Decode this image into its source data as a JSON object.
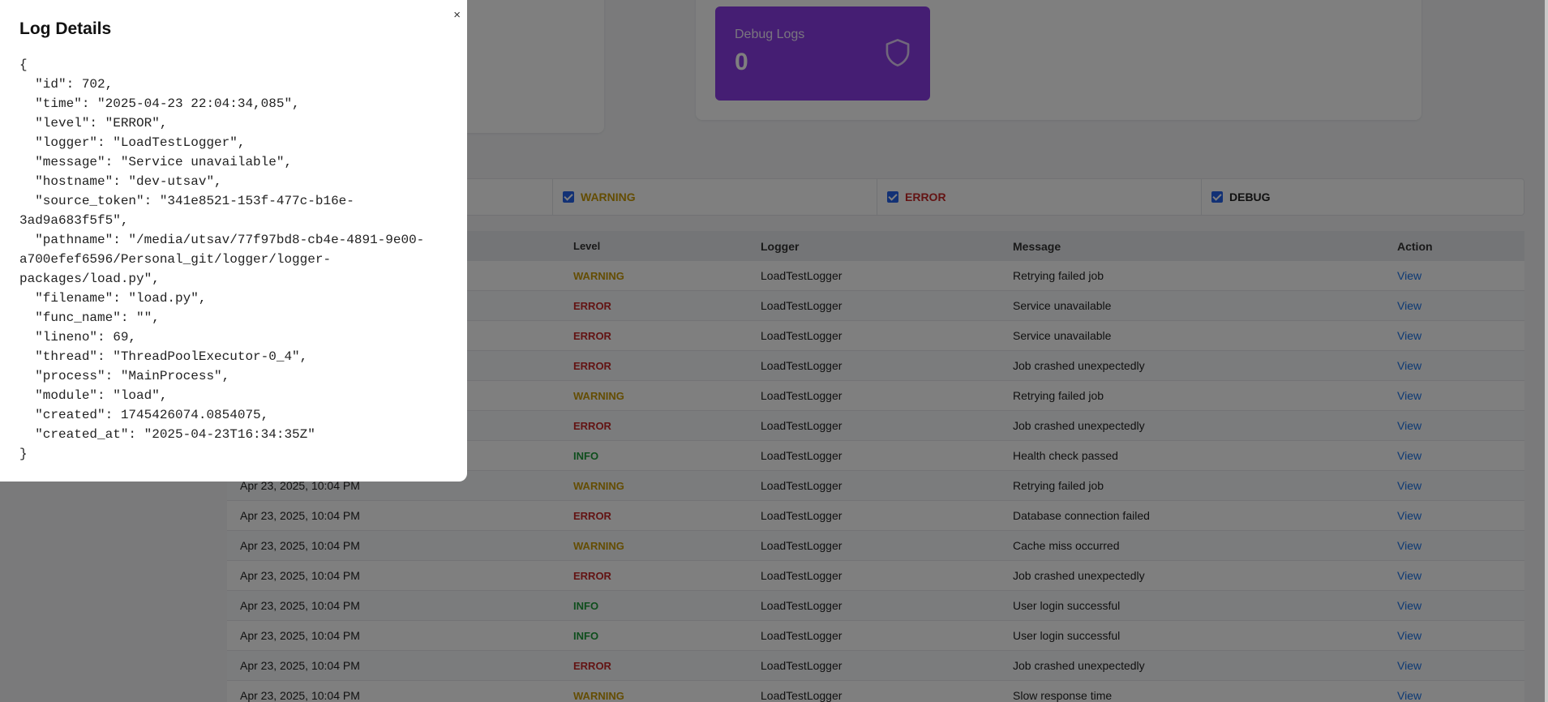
{
  "stats": {
    "debug_label": "Debug Logs",
    "debug_value": "0",
    "debug_icon": "shield-icon"
  },
  "filters": [
    {
      "label": "WARNING",
      "checked": true,
      "color": "#c99a06"
    },
    {
      "label": "ERROR",
      "checked": true,
      "color": "#c62828"
    },
    {
      "label": "DEBUG",
      "checked": true,
      "color": "#222222"
    }
  ],
  "table": {
    "headers": {
      "level": "Level",
      "logger": "Logger",
      "message": "Message",
      "action": "Action"
    },
    "rows": [
      {
        "ts": "",
        "level": "WARNING",
        "logger": "LoadTestLogger",
        "message": "Retrying failed job",
        "action": "View"
      },
      {
        "ts": "",
        "level": "ERROR",
        "logger": "LoadTestLogger",
        "message": "Service unavailable",
        "action": "View"
      },
      {
        "ts": "",
        "level": "ERROR",
        "logger": "LoadTestLogger",
        "message": "Service unavailable",
        "action": "View"
      },
      {
        "ts": "",
        "level": "ERROR",
        "logger": "LoadTestLogger",
        "message": "Job crashed unexpectedly",
        "action": "View"
      },
      {
        "ts": "",
        "level": "WARNING",
        "logger": "LoadTestLogger",
        "message": "Retrying failed job",
        "action": "View"
      },
      {
        "ts": "",
        "level": "ERROR",
        "logger": "LoadTestLogger",
        "message": "Job crashed unexpectedly",
        "action": "View"
      },
      {
        "ts": "",
        "level": "INFO",
        "logger": "LoadTestLogger",
        "message": "Health check passed",
        "action": "View"
      },
      {
        "ts": "Apr 23, 2025, 10:04 PM",
        "level": "WARNING",
        "logger": "LoadTestLogger",
        "message": "Retrying failed job",
        "action": "View"
      },
      {
        "ts": "Apr 23, 2025, 10:04 PM",
        "level": "ERROR",
        "logger": "LoadTestLogger",
        "message": "Database connection failed",
        "action": "View"
      },
      {
        "ts": "Apr 23, 2025, 10:04 PM",
        "level": "WARNING",
        "logger": "LoadTestLogger",
        "message": "Cache miss occurred",
        "action": "View"
      },
      {
        "ts": "Apr 23, 2025, 10:04 PM",
        "level": "ERROR",
        "logger": "LoadTestLogger",
        "message": "Job crashed unexpectedly",
        "action": "View"
      },
      {
        "ts": "Apr 23, 2025, 10:04 PM",
        "level": "INFO",
        "logger": "LoadTestLogger",
        "message": "User login successful",
        "action": "View"
      },
      {
        "ts": "Apr 23, 2025, 10:04 PM",
        "level": "INFO",
        "logger": "LoadTestLogger",
        "message": "User login successful",
        "action": "View"
      },
      {
        "ts": "Apr 23, 2025, 10:04 PM",
        "level": "ERROR",
        "logger": "LoadTestLogger",
        "message": "Job crashed unexpectedly",
        "action": "View"
      },
      {
        "ts": "Apr 23, 2025, 10:04 PM",
        "level": "WARNING",
        "logger": "LoadTestLogger",
        "message": "Slow response time",
        "action": "View"
      }
    ]
  },
  "modal": {
    "title": "Log Details",
    "close": "×",
    "json_text": "{\n  \"id\": 702,\n  \"time\": \"2025-04-23 22:04:34,085\",\n  \"level\": \"ERROR\",\n  \"logger\": \"LoadTestLogger\",\n  \"message\": \"Service unavailable\",\n  \"hostname\": \"dev-utsav\",\n  \"source_token\": \"341e8521-153f-477c-b16e-3ad9a683f5f5\",\n  \"pathname\": \"/media/utsav/77f97bd8-cb4e-4891-9e00-a700efef6596/Personal_git/logger/logger-packages/load.py\",\n  \"filename\": \"load.py\",\n  \"func_name\": \"\",\n  \"lineno\": 69,\n  \"thread\": \"ThreadPoolExecutor-0_4\",\n  \"process\": \"MainProcess\",\n  \"module\": \"load\",\n  \"created\": 1745426074.0854075,\n  \"created_at\": \"2025-04-23T16:34:35Z\"\n}"
  }
}
